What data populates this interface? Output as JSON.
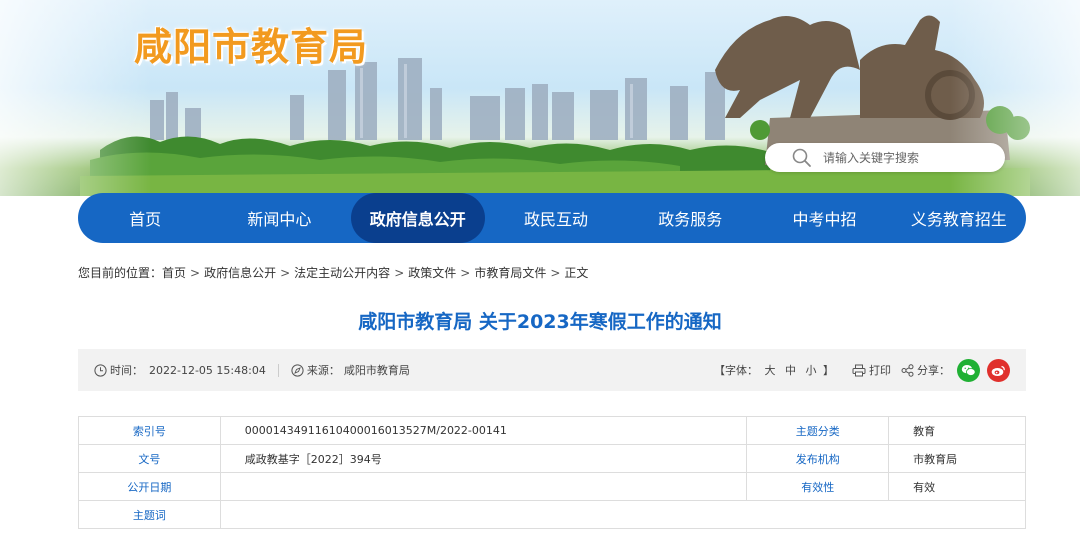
{
  "site": {
    "title": "咸阳市教育局"
  },
  "search": {
    "placeholder": "请输入关键字搜索"
  },
  "nav": {
    "items": [
      {
        "label": "首页"
      },
      {
        "label": "新闻中心"
      },
      {
        "label": "政府信息公开",
        "active": true
      },
      {
        "label": "政民互动"
      },
      {
        "label": "政务服务"
      },
      {
        "label": "中考中招"
      },
      {
        "label": "义务教育招生"
      }
    ]
  },
  "breadcrumb": {
    "prefix": "您目前的位置：",
    "items": [
      "首页",
      "政府信息公开",
      "法定主动公开内容",
      "政策文件",
      "市教育局文件",
      "正文"
    ],
    "separator": ">"
  },
  "article": {
    "title": "咸阳市教育局 关于2023年寒假工作的通知"
  },
  "meta": {
    "time_label": "时间：",
    "time_value": "2022-12-05 15:48:04",
    "source_label": "来源：",
    "source_value": "咸阳市教育局",
    "font_label": "【字体：",
    "font_large": "大",
    "font_medium": "中",
    "font_small": "小",
    "font_close": "】",
    "print_label": "打印",
    "share_label": "分享："
  },
  "info": {
    "index_label": "索引号",
    "index_value": "00001434911610400016013527M/2022-00141",
    "topic_label": "主题分类",
    "topic_value": "教育",
    "doc_label": "文号",
    "doc_value": "咸政教基字［2022］394号",
    "org_label": "发布机构",
    "org_value": "市教育局",
    "date_label": "公开日期",
    "date_value": "",
    "validity_label": "有效性",
    "validity_value": "有效",
    "keyword_label": "主题词",
    "keyword_value": ""
  },
  "colors": {
    "brand_blue": "#1667c4",
    "nav_active": "#0a3f8e",
    "title_orange": "#f29a1f",
    "wechat_green": "#20b034",
    "weibo_red": "#e0302c"
  },
  "icons": [
    "search-icon",
    "clock-icon",
    "compass-icon",
    "printer-icon",
    "share-icon",
    "wechat-icon",
    "weibo-icon"
  ]
}
